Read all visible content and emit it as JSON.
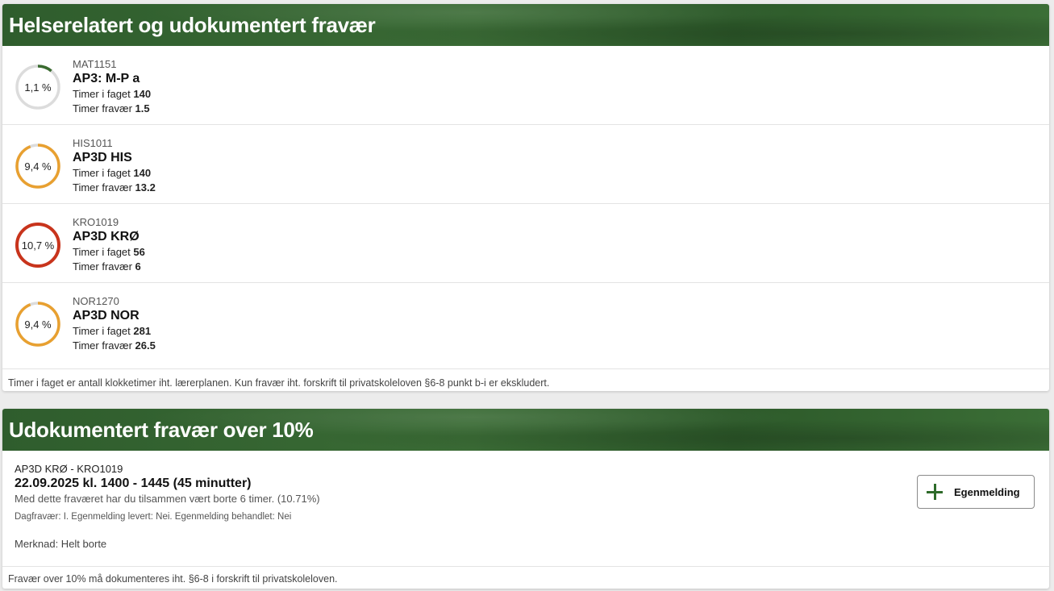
{
  "section1": {
    "title": "Helserelatert og udokumentert fravær",
    "courses": [
      {
        "code": "MAT1151",
        "name": "AP3: M-P a",
        "hours_label": "Timer i faget",
        "hours": "140",
        "absence_label": "Timer fravær",
        "absence": "1.5",
        "percent_label": "1,1 %",
        "percent": 1.1,
        "color": "#3a6b30"
      },
      {
        "code": "HIS1011",
        "name": "AP3D HIS",
        "hours_label": "Timer i faget",
        "hours": "140",
        "absence_label": "Timer fravær",
        "absence": "13.2",
        "percent_label": "9,4 %",
        "percent": 9.4,
        "color": "#e8a030"
      },
      {
        "code": "KRO1019",
        "name": "AP3D KRØ",
        "hours_label": "Timer i faget",
        "hours": "56",
        "absence_label": "Timer fravær",
        "absence": "6",
        "percent_label": "10,7 %",
        "percent": 10.7,
        "color": "#c8341c"
      },
      {
        "code": "NOR1270",
        "name": "AP3D NOR",
        "hours_label": "Timer i faget",
        "hours": "281",
        "absence_label": "Timer fravær",
        "absence": "26.5",
        "percent_label": "9,4 %",
        "percent": 9.4,
        "color": "#e8a030"
      }
    ],
    "footnote": "Timer i faget er antall klokketimer iht. lærerplanen. Kun fravær iht. forskrift til privatskoleloven §6-8 punkt b-i er ekskludert."
  },
  "section2": {
    "title": "Udokumentert fravær over 10%",
    "entry": {
      "course": "AP3D KRØ - KRO1019",
      "date": "22.09.2025 kl. 1400 - 1445 (45 minutter)",
      "summary": "Med dette fraværet har du tilsammen vært borte 6 timer. (10.71%)",
      "meta": "Dagfravær: I. Egenmelding levert: Nei. Egenmelding behandlet: Nei",
      "note": "Merknad: Helt borte",
      "button_label": "Egenmelding",
      "button_icon": "plus-icon"
    },
    "footnote": "Fravær over 10% må dokumenteres iht. §6-8 i forskrift til privatskoleloven."
  }
}
